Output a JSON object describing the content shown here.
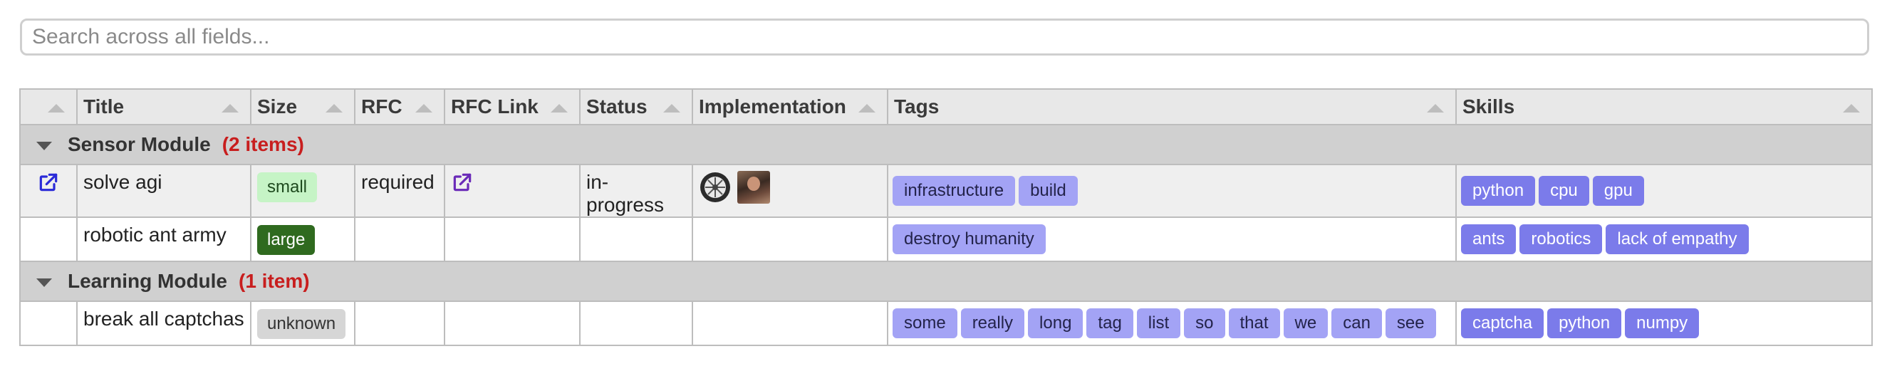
{
  "search": {
    "placeholder": "Search across all fields..."
  },
  "columns": [
    "",
    "Title",
    "Size",
    "RFC",
    "RFC Link",
    "Status",
    "Implementation",
    "Tags",
    "Skills"
  ],
  "groups": [
    {
      "label": "Sensor Module",
      "count": "(2 items)",
      "rows": [
        {
          "title": "solve agi",
          "size": "small",
          "rfc": "required",
          "status": "in-progress",
          "has_link": true,
          "tags": [
            "infrastructure",
            "build"
          ],
          "skills": [
            "python",
            "cpu",
            "gpu"
          ]
        },
        {
          "title": "robotic ant army",
          "size": "large",
          "rfc": "",
          "status": "",
          "has_link": false,
          "tags": [
            "destroy humanity"
          ],
          "skills": [
            "ants",
            "robotics",
            "lack of empathy"
          ]
        }
      ]
    },
    {
      "label": "Learning Module",
      "count": "(1 item)",
      "rows": [
        {
          "title": "break all captchas",
          "size": "unknown",
          "rfc": "",
          "status": "",
          "has_link": false,
          "tags": [
            "some",
            "really",
            "long",
            "tag",
            "list",
            "so",
            "that",
            "we",
            "can",
            "see"
          ],
          "skills": [
            "captcha",
            "python",
            "numpy"
          ]
        }
      ]
    }
  ],
  "colors": {
    "tag_bg": "#a3a3f5",
    "skill_bg": "#7b7bea",
    "size_small": "#c6f4c6",
    "size_large": "#2f6a1f",
    "size_unknown": "#d6d6d6",
    "group_count": "#c81e1e",
    "link_icon": "#2a2ad8"
  },
  "icons": {
    "external_link": "external-link-icon",
    "sort": "sort-ascending-icon",
    "group_toggle": "caret-down-icon",
    "implementation": [
      "wheel-icon",
      "avatar"
    ]
  }
}
